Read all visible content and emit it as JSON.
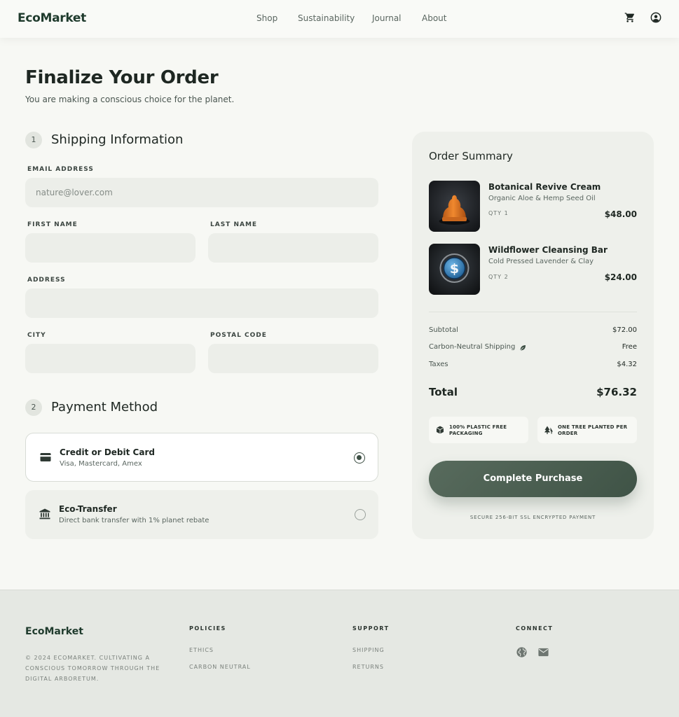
{
  "header": {
    "logo": "EcoMarket",
    "nav": [
      "Shop",
      "Sustainability",
      "Journal",
      "About"
    ],
    "icons": [
      "cart-icon",
      "account-circle-icon"
    ]
  },
  "page": {
    "title": "Finalize Your Order",
    "subtitle": "You are making a conscious choice for the planet."
  },
  "shipping": {
    "step": "1",
    "title": "Shipping Information",
    "email_label": "EMAIL ADDRESS",
    "email_placeholder": "nature@lover.com",
    "first_name_label": "FIRST NAME",
    "last_name_label": "LAST NAME",
    "address_label": "ADDRESS",
    "city_label": "CITY",
    "postal_label": "POSTAL CODE"
  },
  "payment": {
    "step": "2",
    "title": "Payment Method",
    "options": [
      {
        "title": "Credit or Debit Card",
        "desc": "Visa, Mastercard, Amex",
        "icon": "credit-card-icon",
        "selected": true
      },
      {
        "title": "Eco-Transfer",
        "desc": "Direct bank transfer with 1% planet rebate",
        "icon": "bank-icon",
        "selected": false
      }
    ]
  },
  "summary": {
    "title": "Order Summary",
    "items": [
      {
        "name": "Botanical Revive Cream",
        "desc": "Organic Aloe & Hemp Seed Oil",
        "qty": "QTY 1",
        "price": "$48.00"
      },
      {
        "name": "Wildflower Cleansing Bar",
        "desc": "Cold Pressed Lavender & Clay",
        "qty": "QTY 2",
        "price": "$24.00"
      }
    ],
    "subtotal_label": "Subtotal",
    "subtotal": "$72.00",
    "shipping_label": "Carbon-Neutral Shipping",
    "shipping": "Free",
    "taxes_label": "Taxes",
    "taxes": "$4.32",
    "total_label": "Total",
    "total": "$76.32",
    "badges": [
      "100% PLASTIC FREE PACKAGING",
      "ONE TREE PLANTED PER ORDER"
    ],
    "cta": "Complete Purchase",
    "secure": "SECURE 256-BIT SSL ENCRYPTED PAYMENT"
  },
  "footer": {
    "logo": "EcoMarket",
    "copyright": "© 2024 ECOMARKET. CULTIVATING A CONSCIOUS TOMORROW THROUGH THE DIGITAL ARBORETUM.",
    "policies_head": "POLICIES",
    "policies": [
      "ETHICS",
      "CARBON NEUTRAL"
    ],
    "support_head": "SUPPORT",
    "support": [
      "SHIPPING",
      "RETURNS"
    ],
    "connect_head": "CONNECT"
  },
  "colors": {
    "brand": "#1f3b2d",
    "accent": "#3f5346",
    "background": "#f7f8f4"
  }
}
